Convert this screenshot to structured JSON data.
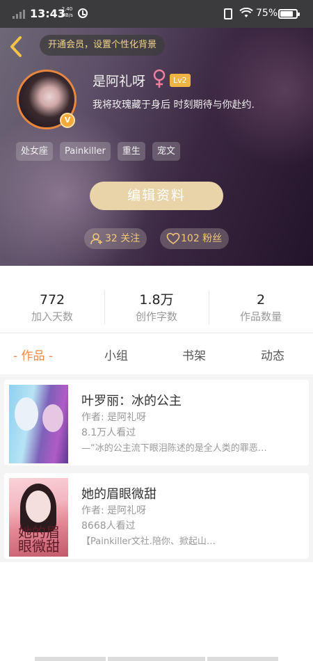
{
  "status_bar": {
    "time": "13:43",
    "net_speed_value": "2.40",
    "net_speed_unit": "MB/s",
    "battery_percent": "75%"
  },
  "header": {
    "vip_prompt": "开通会员，设置个性化背景",
    "username": "是阿礼呀",
    "gender": "♀",
    "level": "Lv2",
    "vip_badge": "V",
    "bio": "我将玫瑰藏于身后 时刻期待与你赴约.",
    "tags": [
      "处女座",
      "Painkiller",
      "重生",
      "宠文"
    ],
    "edit_button": "编辑资料",
    "follow": "32 关注",
    "fans": "102 粉丝"
  },
  "stats": [
    {
      "value": "772",
      "label": "加入天数"
    },
    {
      "value": "1.8万",
      "label": "创作字数"
    },
    {
      "value": "2",
      "label": "作品数量"
    }
  ],
  "tabs": [
    "- 作品 -",
    "小组",
    "书架",
    "动态"
  ],
  "works": [
    {
      "title": "叶罗丽：冰的公主",
      "author": "作者: 是阿礼呀",
      "views": "8.1万人看过",
      "desc": "—“冰的公主流下眼泪陈述的是全人类的罪恶…"
    },
    {
      "title": "她的眉眼微甜",
      "author": "作者: 是阿礼呀",
      "views": "8668人看过",
      "desc": "【Painkiller文社.陪你、掀起山…",
      "cover_text": "她的眉眼微甜"
    }
  ],
  "colors": {
    "accent": "#f08a4b",
    "gold": "#f2c97a",
    "edit_button": "#e8d4a8"
  }
}
